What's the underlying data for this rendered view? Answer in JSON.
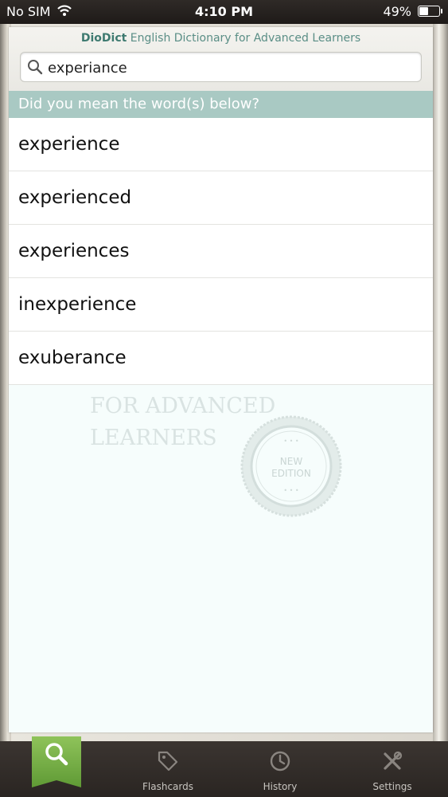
{
  "status_bar": {
    "carrier": "No SIM",
    "time": "4:10 PM",
    "battery_text": "49%",
    "battery_level": 0.49
  },
  "header": {
    "brand": "DioDict",
    "title_rest": " English Dictionary for Advanced Learners"
  },
  "search": {
    "value": "experiance"
  },
  "suggestion_banner": "Did you mean the word(s) below?",
  "suggestions": [
    "experience",
    "experienced",
    "experiences",
    "inexperience",
    "exuberance"
  ],
  "watermark": {
    "line1": "FOR ADVANCED",
    "line2": "LEARNERS",
    "seal_line1": "NEW",
    "seal_line2": "EDITION"
  },
  "tabs": [
    {
      "label": "",
      "icon": "search-icon",
      "active": true
    },
    {
      "label": "Flashcards",
      "icon": "tag-icon"
    },
    {
      "label": "History",
      "icon": "clock-icon"
    },
    {
      "label": "Settings",
      "icon": "tools-icon"
    }
  ],
  "colors": {
    "accent_green": "#6ea93f",
    "banner": "#a9c9c3",
    "brand_teal": "#3e7a70"
  }
}
